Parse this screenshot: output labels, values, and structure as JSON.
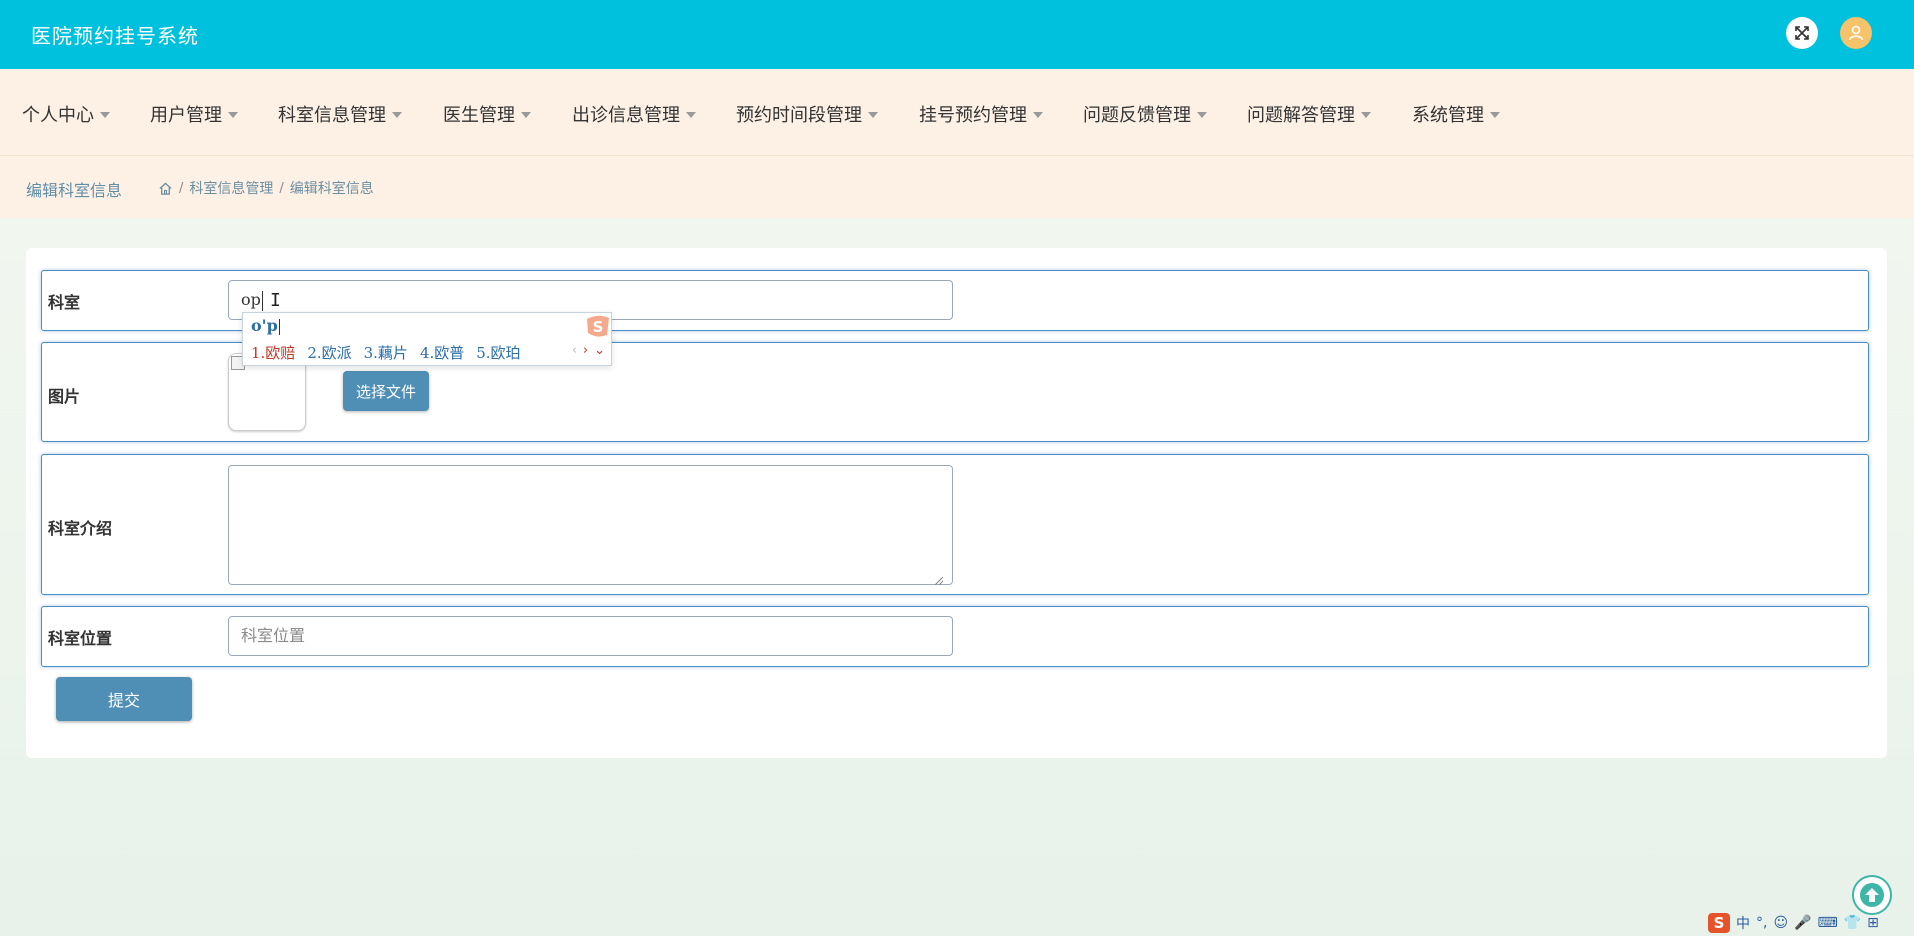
{
  "app": {
    "title": "医院预约挂号系统"
  },
  "header": {
    "icons": [
      "expand-icon",
      "user-avatar-icon"
    ]
  },
  "nav": {
    "items": [
      {
        "label": "个人中心"
      },
      {
        "label": "用户管理"
      },
      {
        "label": "科室信息管理"
      },
      {
        "label": "医生管理"
      },
      {
        "label": "出诊信息管理"
      },
      {
        "label": "预约时间段管理"
      },
      {
        "label": "挂号预约管理"
      },
      {
        "label": "问题反馈管理"
      },
      {
        "label": "问题解答管理"
      },
      {
        "label": "系统管理"
      }
    ]
  },
  "breadcrumb": {
    "page_title": "编辑科室信息",
    "items": [
      "科室信息管理",
      "编辑科室信息"
    ],
    "separator": "/"
  },
  "form": {
    "department": {
      "label": "科室",
      "value": "op"
    },
    "image": {
      "label": "图片",
      "button": "选择文件"
    },
    "intro": {
      "label": "科室介绍",
      "value": ""
    },
    "location": {
      "label": "科室位置",
      "placeholder": "科室位置"
    },
    "submit": "提交"
  },
  "ime": {
    "composition": "o'p",
    "candidates": [
      "1.欧赔",
      "2.欧派",
      "3.藕片",
      "4.欧普",
      "5.欧珀"
    ],
    "logo": "S"
  },
  "tray": {
    "logo": "S",
    "items": [
      "中",
      "°,",
      "☺",
      "🎤",
      "⌨",
      "👕",
      "⊞"
    ]
  },
  "colors": {
    "header_bg": "#00c1dd",
    "nav_bg": "#fdf1e6",
    "accent_button": "#4f8fb5",
    "row_border": "#4b8cc4"
  }
}
